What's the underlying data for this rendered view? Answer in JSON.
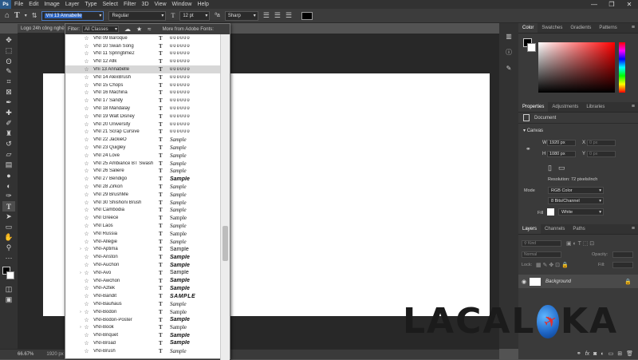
{
  "menubar": {
    "logo": "Ps",
    "items": [
      "File",
      "Edit",
      "Image",
      "Layer",
      "Type",
      "Select",
      "Filter",
      "3D",
      "View",
      "Window",
      "Help"
    ],
    "window_controls": [
      "—",
      "❐",
      "✕"
    ]
  },
  "options": {
    "font_name": "Vni 13 Annabelle",
    "font_style": "Regular",
    "font_size": "12 pt",
    "antialias": "Sharp",
    "text_color": "#000000"
  },
  "document": {
    "tab_title": "Logo 24h công nghệ",
    "zoom": "66.67%",
    "dims": "1920 px"
  },
  "font_panel": {
    "filter_label": "Filter:",
    "filter_value": "All Classes",
    "more_fonts": "More from Adobe Fonts:",
    "fonts": [
      {
        "name": "VNI 09 Baroque",
        "sample": "ᴜᴜᴜᴜᴜᴜ",
        "style": "boxes"
      },
      {
        "name": "VNI 10 Swan Song",
        "sample": "ᴜᴜᴜᴜᴜᴜ",
        "style": "boxes"
      },
      {
        "name": "VNI 11 Springtime2",
        "sample": "ᴜᴜᴜᴜᴜᴜ",
        "style": "boxes"
      },
      {
        "name": "VNI 12 Allk",
        "sample": "ᴜᴜᴜᴜᴜᴜ",
        "style": "boxes"
      },
      {
        "name": "Vni 13 Annabelle",
        "sample": "ᴜᴜᴜᴜᴜᴜ",
        "style": "boxes",
        "selected": true
      },
      {
        "name": "VNI 14 AlexBrush",
        "sample": "ᴜᴜᴜᴜᴜᴜ",
        "style": "boxes"
      },
      {
        "name": "VNI 15 Chops",
        "sample": "ᴜᴜᴜᴜᴜᴜ",
        "style": "boxes"
      },
      {
        "name": "VNI 16 Machina",
        "sample": "ᴜᴜᴜᴜᴜᴜ",
        "style": "boxes"
      },
      {
        "name": "VNI 17 Sandy",
        "sample": "ᴜᴜᴜᴜᴜᴜ",
        "style": "boxes"
      },
      {
        "name": "VNI 18 Mandalay",
        "sample": "ᴜᴜᴜᴜᴜᴜ",
        "style": "boxes"
      },
      {
        "name": "VNI 19 Walt Disney",
        "sample": "ᴜᴜᴜᴜᴜᴜ",
        "style": "boxes"
      },
      {
        "name": "VNI 20 University",
        "sample": "ᴜᴜᴜᴜᴜᴜ",
        "style": "boxes"
      },
      {
        "name": "VNI 21 Scrap Cursive",
        "sample": "ᴜᴜᴜᴜᴜᴜ",
        "style": "boxes"
      },
      {
        "name": "VNI 22 JackieO",
        "sample": "Sample",
        "style": "script"
      },
      {
        "name": "VNI 23 Quigley",
        "sample": "Sample",
        "style": "script"
      },
      {
        "name": "VNI 24 Love",
        "sample": "Sample",
        "style": "script"
      },
      {
        "name": "VNI 25 Ambiance BT Swash",
        "sample": "Sample",
        "style": "script"
      },
      {
        "name": "VNI 26 Saliere",
        "sample": "Sample",
        "style": "script"
      },
      {
        "name": "VNI 27 Bendigo",
        "sample": "Sample",
        "style": "bold"
      },
      {
        "name": "VNI 28 Zirkon",
        "sample": "Sample",
        "style": "script"
      },
      {
        "name": "VNI 29 BrushMe",
        "sample": "Sample",
        "style": "script"
      },
      {
        "name": "VNI 30 Shishoni Brush",
        "sample": "Sample",
        "style": "script"
      },
      {
        "name": "VNI Cambodia",
        "sample": "Sample",
        "style": "script"
      },
      {
        "name": "VNI Greece",
        "sample": "Sample",
        "style": "serif"
      },
      {
        "name": "VNI Laos",
        "sample": "Sample",
        "style": "script"
      },
      {
        "name": "VNI Russia",
        "sample": "Sample",
        "style": "serif"
      },
      {
        "name": "VNI-Allegie",
        "sample": "Sample",
        "style": "script"
      },
      {
        "name": "VNI-Aptima",
        "sample": "Sample",
        "style": "plain",
        "arrow": true
      },
      {
        "name": "VNI-Ariston",
        "sample": "Sample",
        "style": "bold"
      },
      {
        "name": "VNI-Auchon",
        "sample": "Sample",
        "style": "bold"
      },
      {
        "name": "VNI-Avo",
        "sample": "Sample",
        "style": "plain",
        "arrow": true
      },
      {
        "name": "VNI-Awchon",
        "sample": "Sample",
        "style": "bold"
      },
      {
        "name": "VNI-Aztek",
        "sample": "Sample",
        "style": "bold"
      },
      {
        "name": "VNI-Bandit",
        "sample": "SAMPLE",
        "style": "caps"
      },
      {
        "name": "VNI-Bauhaus",
        "sample": "Sample",
        "style": "script"
      },
      {
        "name": "VNI-Bodon",
        "sample": "Sample",
        "style": "serif",
        "arrow": true
      },
      {
        "name": "VNI-Bodon-Poster",
        "sample": "Sample",
        "style": "bold"
      },
      {
        "name": "VNI-Book",
        "sample": "Sample",
        "style": "serif",
        "arrow": true
      },
      {
        "name": "VNI-Briquet",
        "sample": "Sample",
        "style": "bold"
      },
      {
        "name": "VNI-Broad",
        "sample": "Sample",
        "style": "bold"
      },
      {
        "name": "VNI-Brush",
        "sample": "Sample",
        "style": "script"
      }
    ]
  },
  "toolbar": {
    "tools": [
      "move-icon",
      "marquee-icon",
      "lasso-icon",
      "quick-select-icon",
      "crop-icon",
      "frame-icon",
      "eyedropper-icon",
      "healing-icon",
      "brush-icon",
      "stamp-icon",
      "history-brush-icon",
      "eraser-icon",
      "gradient-icon",
      "blur-icon",
      "dodge-icon",
      "pen-icon",
      "type-icon",
      "path-select-icon",
      "rectangle-icon",
      "hand-icon",
      "zoom-icon",
      "more-icon"
    ]
  },
  "color_panel": {
    "tabs": [
      "Color",
      "Swatches",
      "Gradients",
      "Patterns"
    ],
    "active": "Color"
  },
  "properties_panel": {
    "tabs": [
      "Properties",
      "Adjustments",
      "Libraries"
    ],
    "document_label": "Document",
    "canvas_label": "Canvas",
    "w_label": "W",
    "w_value": "1920 px",
    "h_label": "H",
    "h_value": "1080 px",
    "x_label": "X",
    "x_value": "0 px",
    "y_label": "Y",
    "y_value": "0 px",
    "resolution": "Resolution: 72 pixels/inch",
    "mode_label": "Mode",
    "mode_value": "RGB Color",
    "bits_value": "8 Bits/Channel",
    "fill_label": "Fill",
    "fill_value": "White"
  },
  "layers_panel": {
    "tabs": [
      "Layers",
      "Channels",
      "Paths"
    ],
    "kind_placeholder": "Kind",
    "blend_mode": "Normal",
    "opacity_label": "Opacity:",
    "lock_label": "Lock:",
    "fill_label": "Fill:",
    "layer_name": "Background"
  },
  "watermark": {
    "left": "LACAL",
    "right": "KA"
  }
}
